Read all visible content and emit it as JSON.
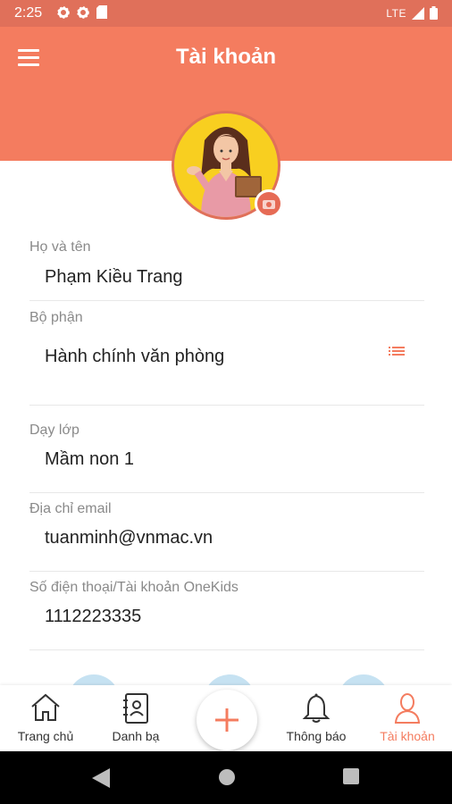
{
  "status_bar": {
    "time": "2:25",
    "network": "LTE"
  },
  "header": {
    "title": "Tài khoản"
  },
  "profile": {
    "fields": [
      {
        "label": "Họ và tên",
        "value": "Phạm Kiều Trang"
      },
      {
        "label": "Bộ phận",
        "value": "Hành chính văn phòng"
      },
      {
        "label": "Dạy lớp",
        "value": "Mầm non 1"
      },
      {
        "label": "Địa chỉ email",
        "value": "tuanminh@vnmac.vn"
      },
      {
        "label": "Số điện thoại/Tài khoản OneKids",
        "value": "1112223335"
      }
    ]
  },
  "bottom_nav": {
    "items": [
      {
        "label": "Trang chủ",
        "icon": "home-icon"
      },
      {
        "label": "Danh bạ",
        "icon": "contacts-icon"
      },
      {
        "label": "Thông báo",
        "icon": "bell-icon"
      },
      {
        "label": "Tài khoản",
        "icon": "user-icon",
        "active": true
      }
    ],
    "fab_icon": "plus-icon"
  },
  "colors": {
    "accent": "#f47c5f",
    "status_bar": "#e0705a",
    "avatar_bg": "#f8cf20"
  }
}
